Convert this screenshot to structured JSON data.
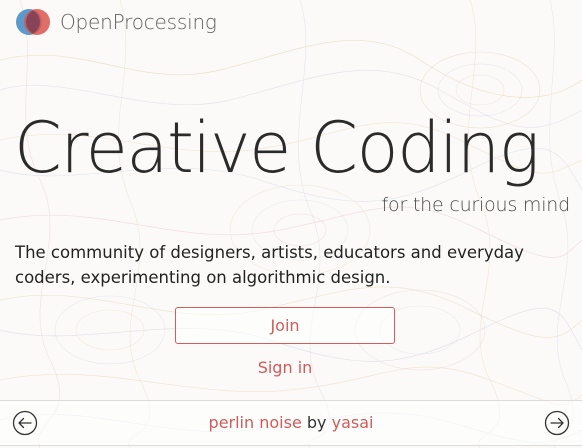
{
  "header": {
    "brand_name": "OpenProcessing"
  },
  "hero": {
    "title": "Creative Coding",
    "subtitle": "for the curious mind",
    "description": "The community of designers, artists, educators and everyday coders, experimenting on algorithmic design."
  },
  "actions": {
    "join_label": "Join",
    "signin_label": "Sign in"
  },
  "featured_sketch": {
    "title": "perlin noise",
    "by_text": "by",
    "author": "yasai"
  },
  "icons": {
    "logo": "openprocessing-logo-icon",
    "prev": "arrow-left-circle-icon",
    "next": "arrow-right-circle-icon"
  },
  "colors": {
    "accent": "#cf5b5b",
    "logo_blue": "#4a8fc7",
    "logo_red": "#d9534f",
    "title_text": "#2b2b2b"
  }
}
